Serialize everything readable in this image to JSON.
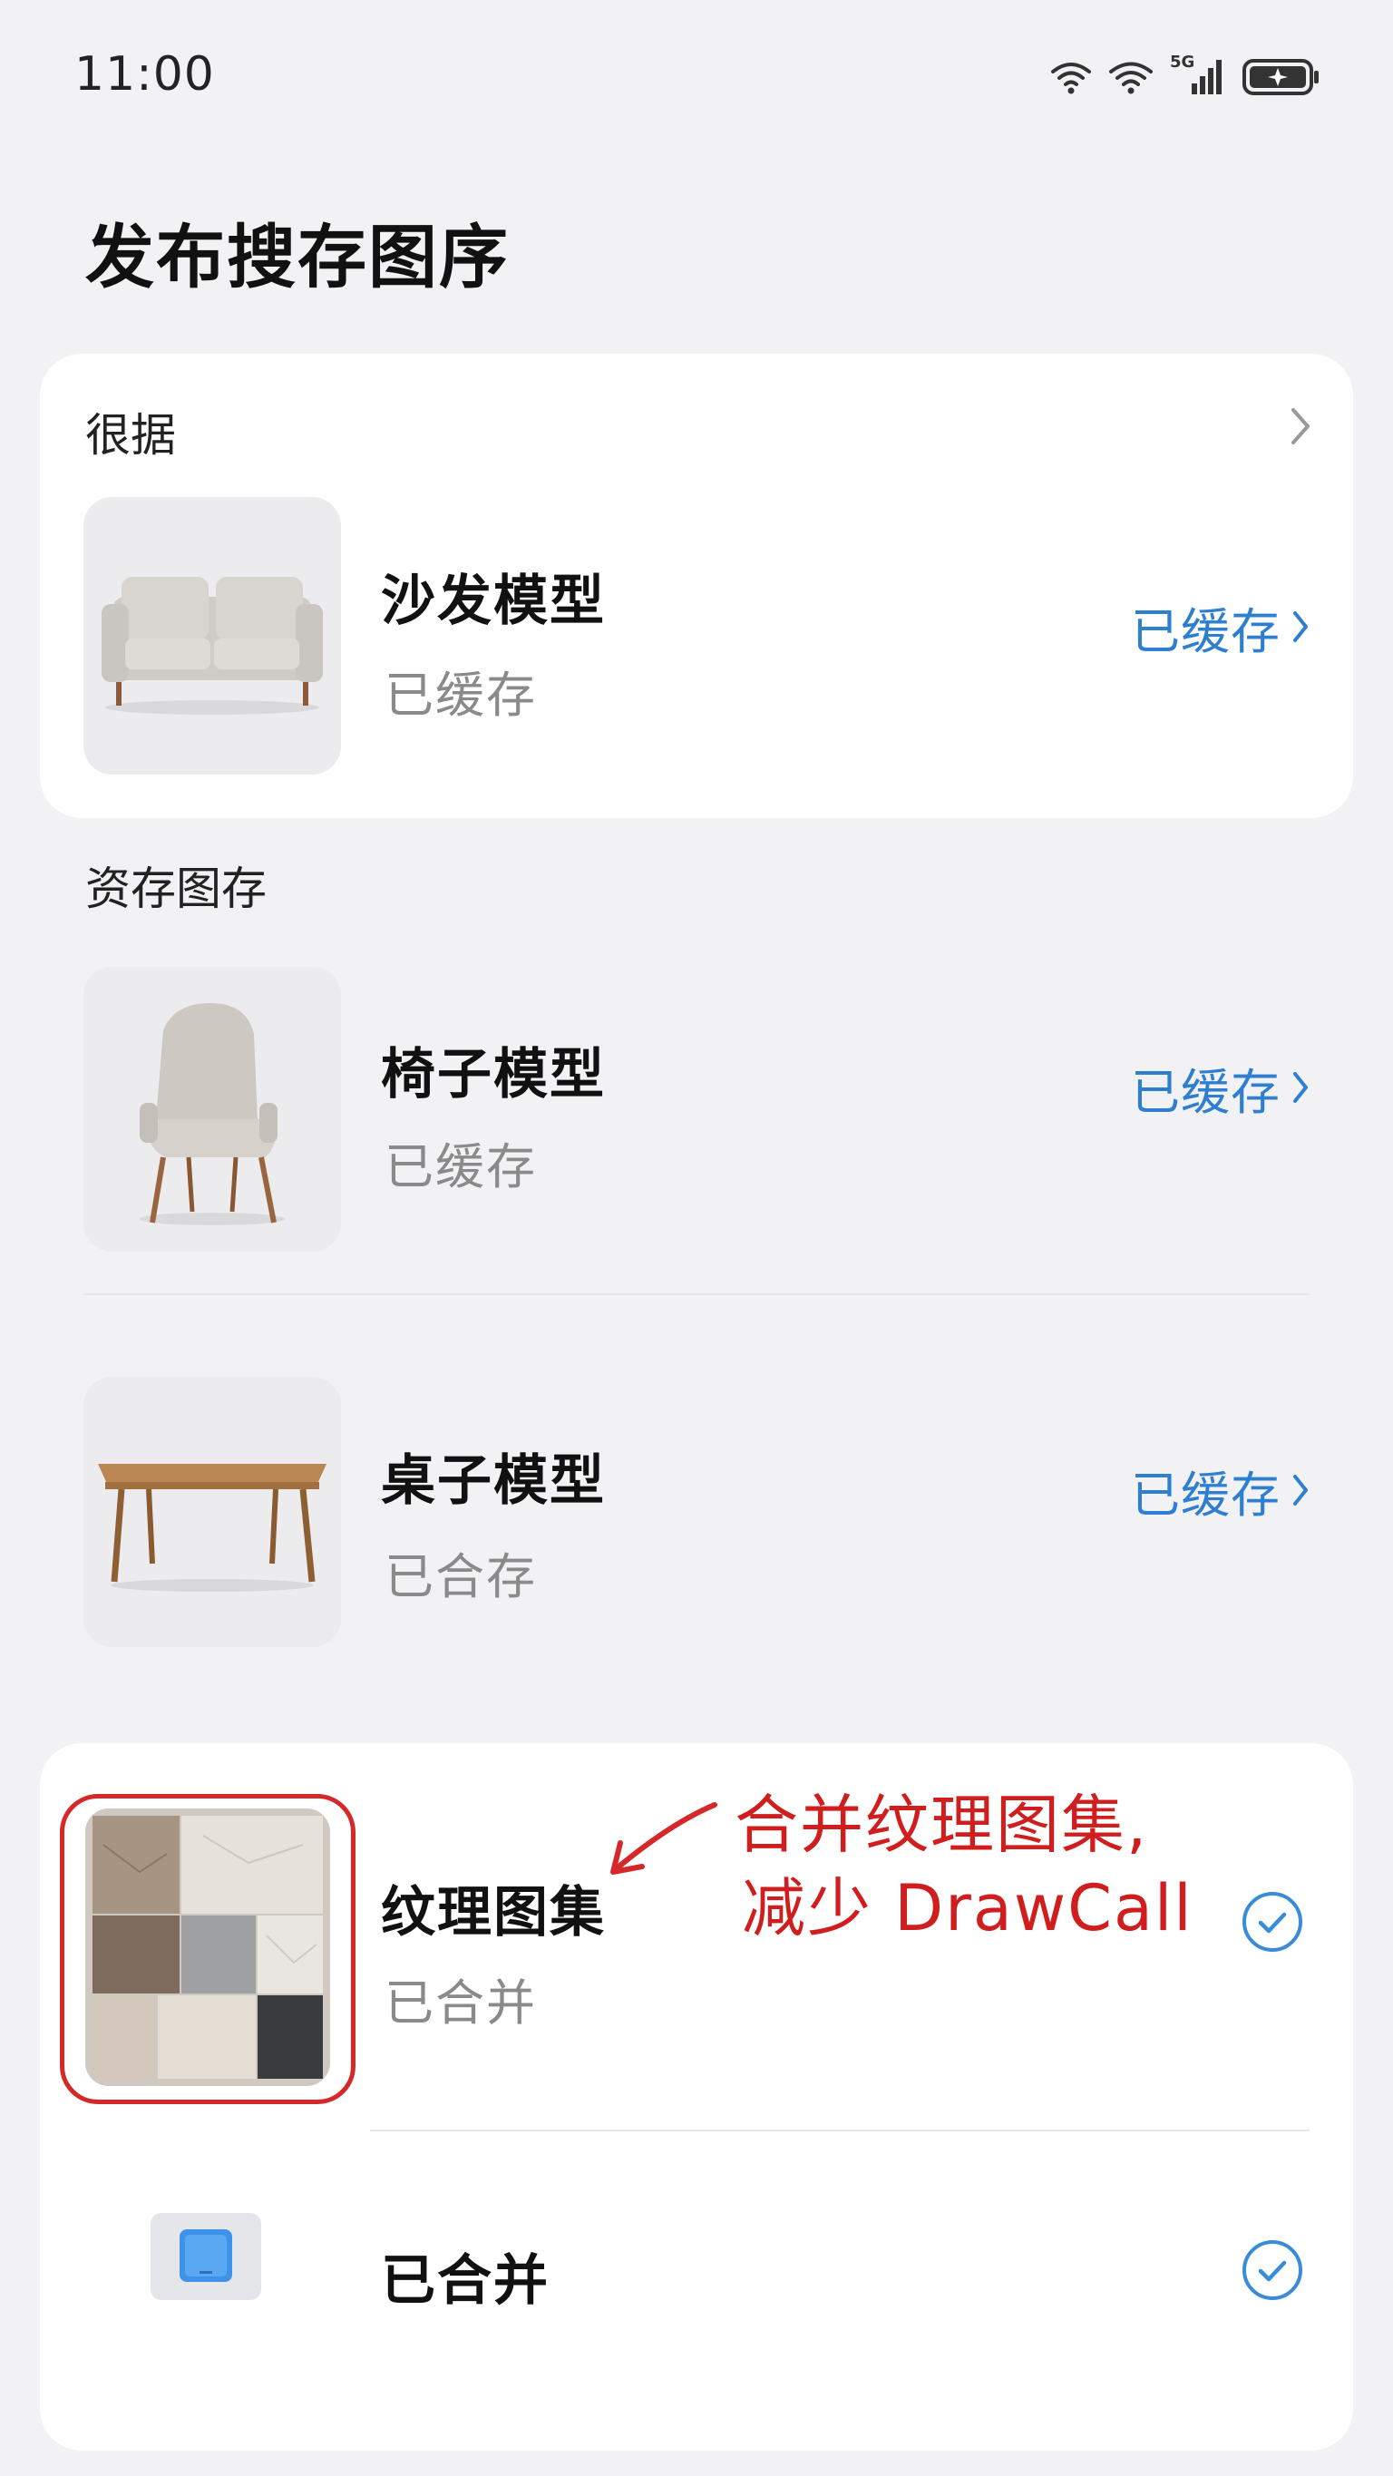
{
  "status": {
    "time": "11:00",
    "network_label": "5G"
  },
  "page": {
    "title": "发布搜存图序"
  },
  "section_a": {
    "label": "很据",
    "items": [
      {
        "name": "沙发模型",
        "status": "已缓存",
        "action": "已缓存",
        "image": "sofa"
      }
    ]
  },
  "section_b": {
    "label": "资存图存",
    "items": [
      {
        "name": "椅子模型",
        "status": "已缓存",
        "action": "已缓存",
        "image": "chair"
      },
      {
        "name": "桌子模型",
        "status": "已合存",
        "action": "已缓存",
        "image": "table"
      }
    ]
  },
  "section_c": {
    "items": [
      {
        "name": "纹理图集",
        "status": "已合并",
        "image": "texture-atlas",
        "checked": true
      },
      {
        "name": "已合并",
        "image": "blue-square-icon",
        "checked": true
      }
    ]
  },
  "annotation": {
    "line1": "合并纹理图集,",
    "line2": "减少 DrawCall",
    "color": "#d01e1e"
  },
  "colors": {
    "accent": "#2f7fd0",
    "annotation": "#d62828",
    "background": "#f2f2f4"
  }
}
